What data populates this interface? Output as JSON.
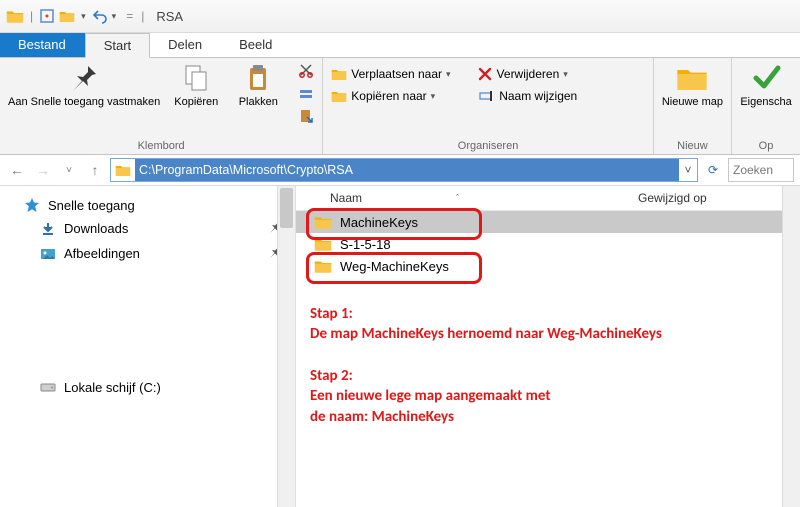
{
  "title": "RSA",
  "tabs": {
    "file": "Bestand",
    "start": "Start",
    "share": "Delen",
    "view": "Beeld"
  },
  "ribbon": {
    "clipboard": {
      "label": "Klembord",
      "pin": "Aan Snelle toegang vastmaken",
      "copy": "Kopiëren",
      "paste": "Plakken"
    },
    "organise": {
      "label": "Organiseren",
      "move_to": "Verplaatsen naar",
      "copy_to": "Kopiëren naar",
      "delete": "Verwijderen",
      "rename": "Naam wijzigen"
    },
    "new": {
      "label": "Nieuw",
      "newfolder": "Nieuwe map"
    },
    "open": {
      "label": "Op",
      "properties": "Eigenscha"
    }
  },
  "address": "C:\\ProgramData\\Microsoft\\Crypto\\RSA",
  "search_placeholder": "Zoeken",
  "navpane": {
    "quick": "Snelle toegang",
    "downloads": "Downloads",
    "pictures": "Afbeeldingen",
    "localdisk": "Lokale schijf (C:)"
  },
  "columns": {
    "name": "Naam",
    "modified": "Gewijzigd op"
  },
  "files": [
    {
      "name": "MachineKeys",
      "selected": true
    },
    {
      "name": "S-1-5-18",
      "selected": false
    },
    {
      "name": "Weg-MachineKeys",
      "selected": false
    }
  ],
  "annotations": {
    "step1_title": "Stap 1:",
    "step1_text": "De map MachineKeys hernoemd naar Weg-MachineKeys",
    "step2_title": "Stap 2:",
    "step2_text1": "Een nieuwe lege map aangemaakt met",
    "step2_text2": "de naam: MachineKeys"
  }
}
